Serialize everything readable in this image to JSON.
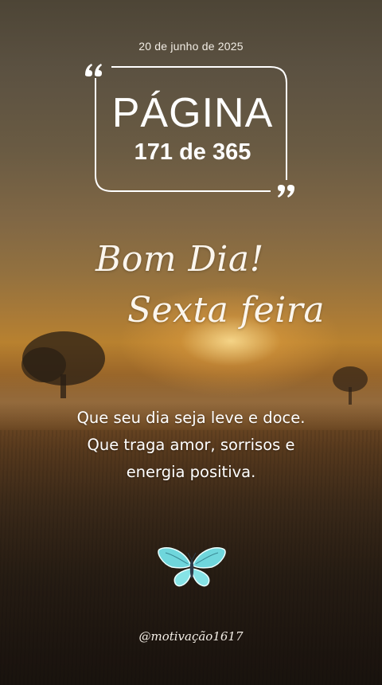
{
  "date": "20 de junho de 2025",
  "page": {
    "label": "PÁGINA",
    "count": "171 de 365"
  },
  "greeting": {
    "line1": "Bom Dia!",
    "line2": "Sexta feira"
  },
  "message": {
    "line1": "Que seu dia seja leve e doce.",
    "line2": "Que traga amor, sorrisos e",
    "line3": "energia positiva."
  },
  "handle": "@motivação1617",
  "icons": {
    "quote_open": "quote-open-icon",
    "quote_close": "quote-close-icon",
    "butterfly": "butterfly-icon"
  },
  "colors": {
    "text": "#ffffff",
    "butterfly": "#6fd6dc",
    "sky_top": "#4d4536",
    "sun": "#ffe296"
  }
}
